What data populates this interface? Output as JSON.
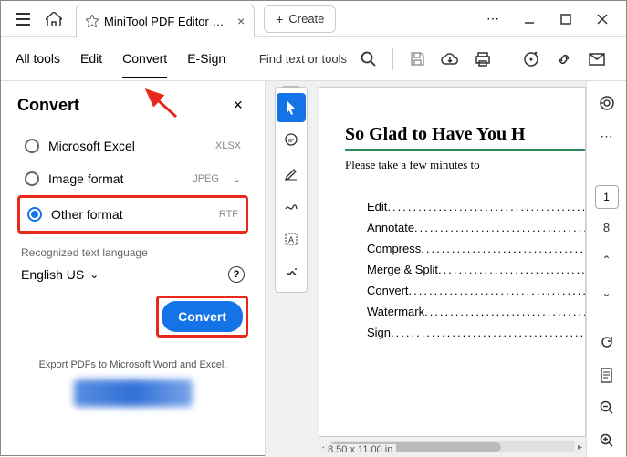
{
  "titlebar": {
    "tab_title": "MiniTool PDF Editor Use...",
    "create_label": "Create"
  },
  "toolbar": {
    "tabs": [
      "All tools",
      "Edit",
      "Convert",
      "E-Sign"
    ],
    "active_index": 2,
    "find_label": "Find text or tools"
  },
  "panel": {
    "title": "Convert",
    "options": [
      {
        "label": "Microsoft Excel",
        "format": "XLSX",
        "selected": false,
        "dropdown": false
      },
      {
        "label": "Image format",
        "format": "JPEG",
        "selected": false,
        "dropdown": true
      },
      {
        "label": "Other format",
        "format": "RTF",
        "selected": true,
        "dropdown": false
      }
    ],
    "lang_label": "Recognized text language",
    "lang_value": "English US",
    "convert_btn": "Convert",
    "footer": "Export PDFs to Microsoft Word and Excel."
  },
  "doc": {
    "title": "So Glad to Have You H",
    "subtitle": "Please take a few minutes to",
    "items": [
      "Edit",
      "Annotate",
      "Compress",
      "Merge & Split",
      "Convert",
      "Watermark",
      "Sign"
    ],
    "page_dim": "8.50 x 11.00 in"
  },
  "rail": {
    "page_current": "1",
    "page_total": "8"
  }
}
